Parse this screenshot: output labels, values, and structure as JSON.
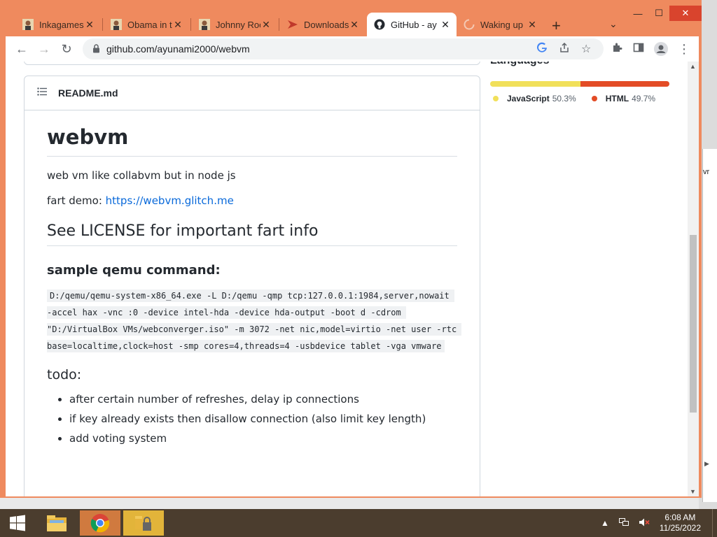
{
  "browser": {
    "tabs": [
      {
        "title": "Inkagames",
        "icon": "avatar-favicon-icon",
        "active": false
      },
      {
        "title": "Obama in th",
        "icon": "avatar-favicon-icon",
        "active": false
      },
      {
        "title": "Johnny Roc",
        "icon": "avatar-favicon-icon",
        "active": false
      },
      {
        "title": "Downloads",
        "icon": "downloads-favicon-icon",
        "active": false
      },
      {
        "title": "GitHub - ay",
        "icon": "github-favicon-icon",
        "active": true
      },
      {
        "title": "Waking up",
        "icon": "loading-spinner-icon",
        "active": false
      }
    ],
    "url": "github.com/ayunami2000/webvm"
  },
  "readme": {
    "filename": "README.md",
    "title": "webvm",
    "intro": "web vm like collabvm but in node js",
    "demo_prefix": "fart demo: ",
    "demo_link": "https://webvm.glitch.me",
    "license_heading": "See LICENSE for important fart info",
    "sample_heading": "sample qemu command:",
    "command": "D:/qemu/qemu-system-x86_64.exe -L D:/qemu -qmp tcp:127.0.0.1:1984,server,nowait -accel hax -vnc :0 -device intel-hda -device hda-output -boot d -cdrom \"D:/VirtualBox VMs/webconverger.iso\" -m 3072 -net nic,model=virtio -net user -rtc base=localtime,clock=host -smp cores=4,threads=4 -usbdevice tablet -vga vmware",
    "todo_heading": "todo:",
    "todo": [
      "after certain number of refreshes, delay ip connections",
      "if key already exists then disallow connection (also limit key length)",
      "add voting system"
    ]
  },
  "languages": {
    "heading": "Languages",
    "items": [
      {
        "name": "JavaScript",
        "percent_label": "50.3%",
        "percent": 50.3,
        "color": "#f1e05a"
      },
      {
        "name": "HTML",
        "percent_label": "49.7%",
        "percent": 49.7,
        "color": "#e34c26"
      }
    ]
  },
  "background_window": {
    "fragment": "vr"
  },
  "taskbar": {
    "apps": [
      "file-explorer-icon",
      "chrome-icon",
      "locked-folder-icon"
    ],
    "time": "6:08 AM",
    "date": "11/25/2022"
  }
}
